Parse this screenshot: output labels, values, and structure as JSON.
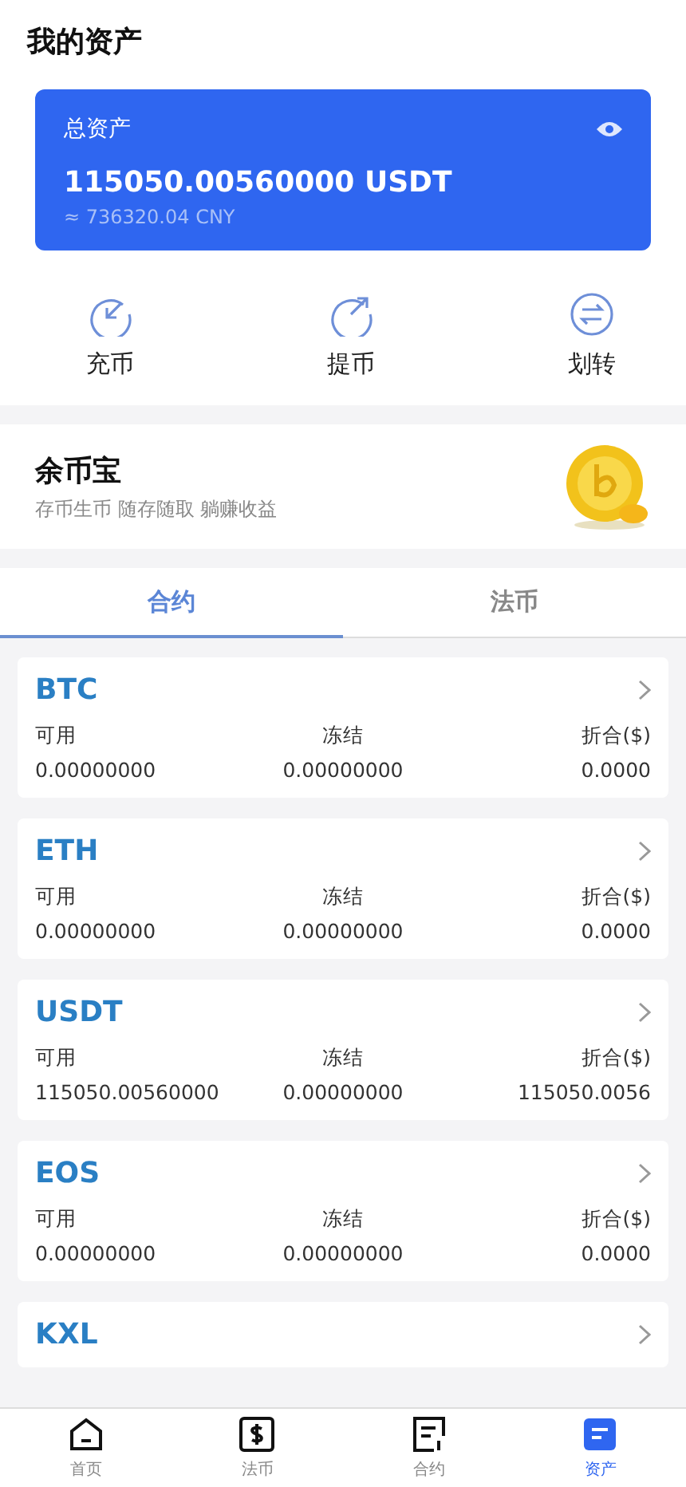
{
  "header": {
    "title": "我的资产"
  },
  "total_card": {
    "label": "总资产",
    "amount": "115050.00560000 USDT",
    "approx": "≈ 736320.04 CNY"
  },
  "actions": [
    {
      "kind": "deposit",
      "label": "充币"
    },
    {
      "kind": "withdraw",
      "label": "提币"
    },
    {
      "kind": "transfer",
      "label": "划转"
    }
  ],
  "promo": {
    "title": "余币宝",
    "subtitle": "存币生币 随存随取 躺赚收益"
  },
  "tabs": [
    {
      "label": "合约",
      "selected": true
    },
    {
      "label": "法币",
      "selected": false
    }
  ],
  "coins": [
    {
      "name": "BTC",
      "columns": [
        {
          "label": "可用",
          "value": "0.00000000"
        },
        {
          "label": "冻结",
          "value": "0.00000000"
        },
        {
          "label": "折合($)",
          "value": "0.0000"
        }
      ]
    },
    {
      "name": "ETH",
      "columns": [
        {
          "label": "可用",
          "value": "0.00000000"
        },
        {
          "label": "冻结",
          "value": "0.00000000"
        },
        {
          "label": "折合($)",
          "value": "0.0000"
        }
      ]
    },
    {
      "name": "USDT",
      "columns": [
        {
          "label": "可用",
          "value": "115050.00560000"
        },
        {
          "label": "冻结",
          "value": "0.00000000"
        },
        {
          "label": "折合($)",
          "value": "115050.0056"
        }
      ]
    },
    {
      "name": "EOS",
      "columns": [
        {
          "label": "可用",
          "value": "0.00000000"
        },
        {
          "label": "冻结",
          "value": "0.00000000"
        },
        {
          "label": "折合($)",
          "value": "0.0000"
        }
      ]
    },
    {
      "name": "KXL"
    }
  ],
  "nav": [
    {
      "kind": "home",
      "label": "首页",
      "selected": false
    },
    {
      "kind": "fiat",
      "label": "法币",
      "selected": false
    },
    {
      "kind": "contract",
      "label": "合约",
      "selected": false
    },
    {
      "kind": "assets",
      "label": "资产",
      "selected": true
    }
  ]
}
